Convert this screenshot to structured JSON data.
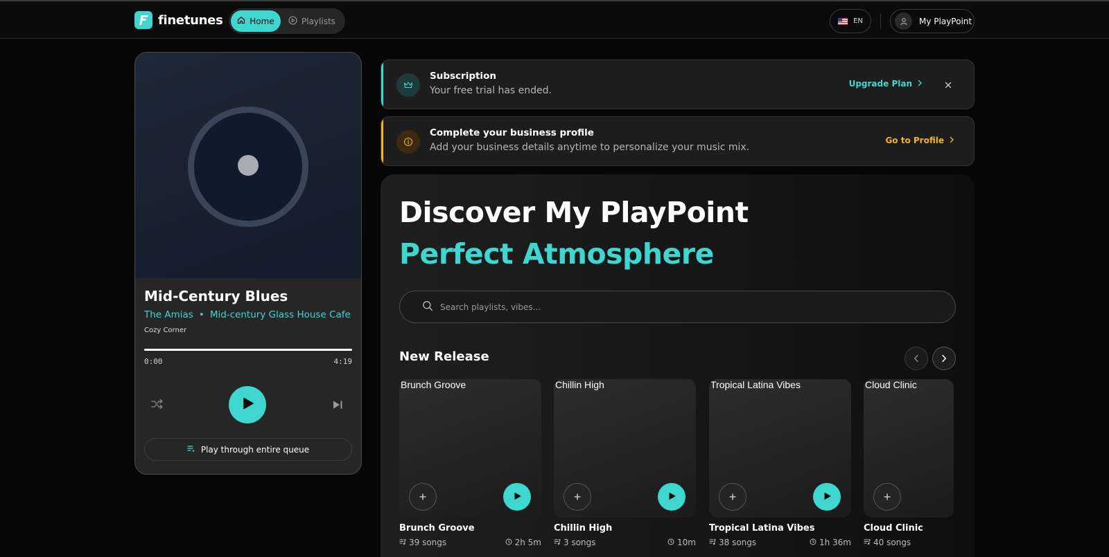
{
  "brand": {
    "name": "finetunes"
  },
  "nav": {
    "home_label": "Home",
    "playlists_label": "Playlists"
  },
  "header": {
    "language": "EN",
    "account_label": "My PlayPoint"
  },
  "player": {
    "title": "Mid-Century Blues",
    "artist": "The Amias",
    "separator": "•",
    "album": "Mid-century Glass House Cafe",
    "zone": "Cozy Corner",
    "time_current": "0:00",
    "time_total": "4:19",
    "progress_fraction": 1.0,
    "queue_label": "Play through entire queue"
  },
  "banners": {
    "subscription": {
      "title": "Subscription",
      "text": "Your free trial has ended.",
      "action": "Upgrade Plan",
      "accent_color": "#3fd6cf"
    },
    "profile": {
      "title": "Complete your business profile",
      "text": "Add your business details anytime to personalize your music mix.",
      "action": "Go to Profile",
      "accent_color": "#f0b429"
    }
  },
  "main": {
    "hero_line1": "Discover My PlayPoint",
    "hero_line2": "Perfect Atmosphere",
    "search_placeholder": "Search playlists, vibes...",
    "section_title": "New Release",
    "cards": [
      {
        "alt": "Brunch Groove",
        "title": "Brunch Groove",
        "songs": "39 songs",
        "duration": "2h 5m"
      },
      {
        "alt": "Chillin High",
        "title": "Chillin High",
        "songs": "3 songs",
        "duration": "10m"
      },
      {
        "alt": "Tropical Latina Vibes",
        "title": "Tropical Latina Vibes",
        "songs": "38 songs",
        "duration": "1h 36m"
      },
      {
        "alt": "Cloud Clinic",
        "title": "Cloud Clinic",
        "songs": "40 songs",
        "duration": ""
      }
    ]
  },
  "colors": {
    "accent": "#3fd6cf",
    "warning": "#f0b429",
    "background": "#060606"
  }
}
